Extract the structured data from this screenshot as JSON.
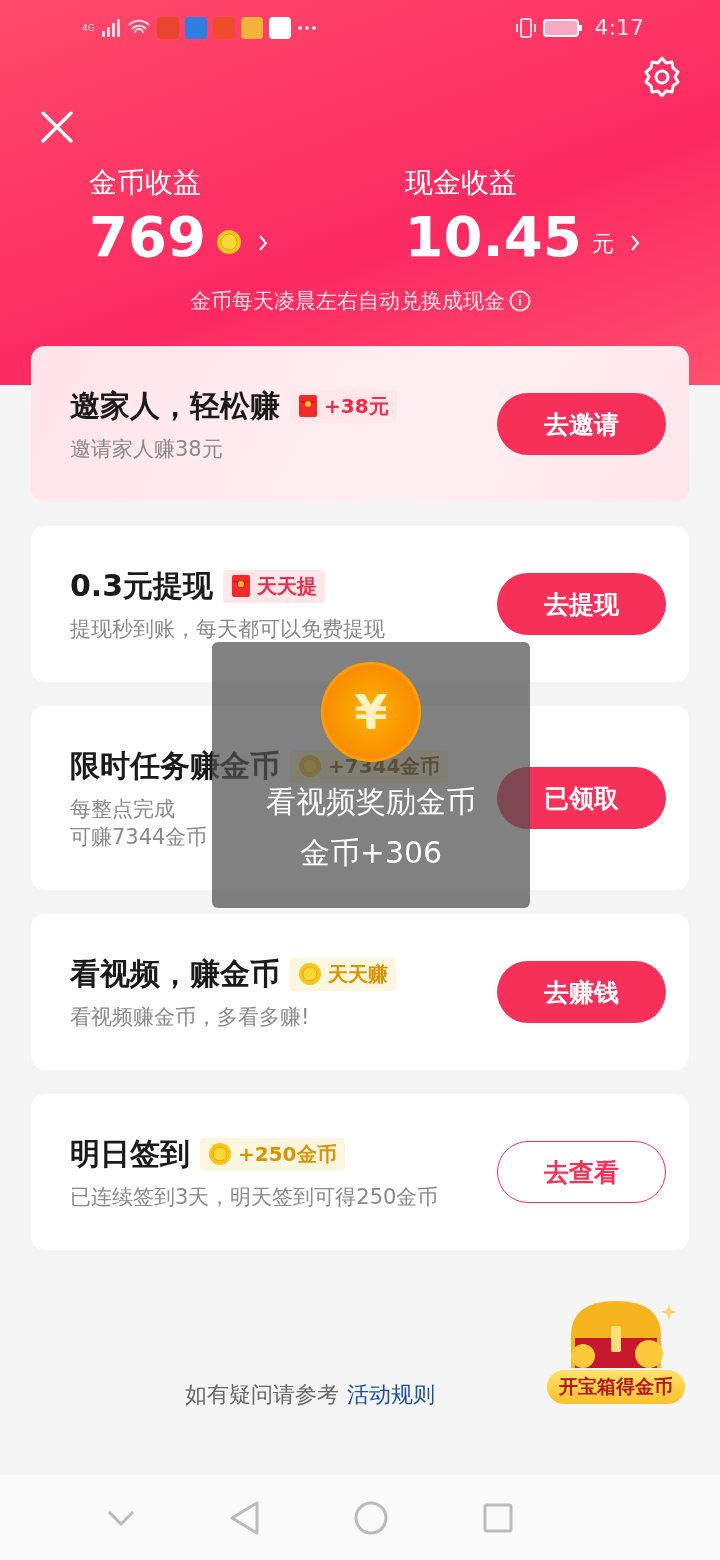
{
  "status_bar": {
    "time": "4:17",
    "network": "4G"
  },
  "header": {
    "stats": [
      {
        "label": "金币收益",
        "value": "769",
        "kind": "coin"
      },
      {
        "label": "现金收益",
        "value": "10.45",
        "unit": "元",
        "kind": "cash"
      }
    ],
    "note": "金币每天凌晨左右自动兑换成现金"
  },
  "tasks": [
    {
      "title": "邀家人，轻松赚",
      "badge": {
        "kind": "redpacket",
        "text": "+38元"
      },
      "subtitle": [
        "邀请家人赚38元"
      ],
      "button": {
        "label": "去邀请",
        "kind": "primary"
      },
      "highlight": true
    },
    {
      "title": "0.3元提现",
      "badge": {
        "kind": "redpacket",
        "text": "天天提"
      },
      "subtitle": [
        "提现秒到账，每天都可以免费提现"
      ],
      "button": {
        "label": "去提现",
        "kind": "primary"
      },
      "highlight": false
    },
    {
      "title": "限时任务赚金币",
      "badge": {
        "kind": "coin",
        "text": "+7344金币"
      },
      "subtitle": [
        "每整点完成",
        "可赚7344金币"
      ],
      "button": {
        "label": "已领取",
        "kind": "primary"
      },
      "highlight": false
    },
    {
      "title": "看视频，赚金币",
      "badge": {
        "kind": "coin",
        "text": "天天赚"
      },
      "subtitle": [
        "看视频赚金币，多看多赚!"
      ],
      "button": {
        "label": "去赚钱",
        "kind": "primary"
      },
      "highlight": false
    },
    {
      "title": "明日签到",
      "badge": {
        "kind": "coin",
        "text": "+250金币"
      },
      "subtitle": [
        "已连续签到3天，明天签到可得250金币"
      ],
      "button": {
        "label": "去查看",
        "kind": "secondary"
      },
      "highlight": false
    }
  ],
  "footer": {
    "text": "如有疑问请参考",
    "link": "活动规则"
  },
  "chest": {
    "label": "开宝箱得金币"
  },
  "toast": {
    "coin_symbol": "¥",
    "title": "看视频奖励金币",
    "amount": "金币+306"
  }
}
